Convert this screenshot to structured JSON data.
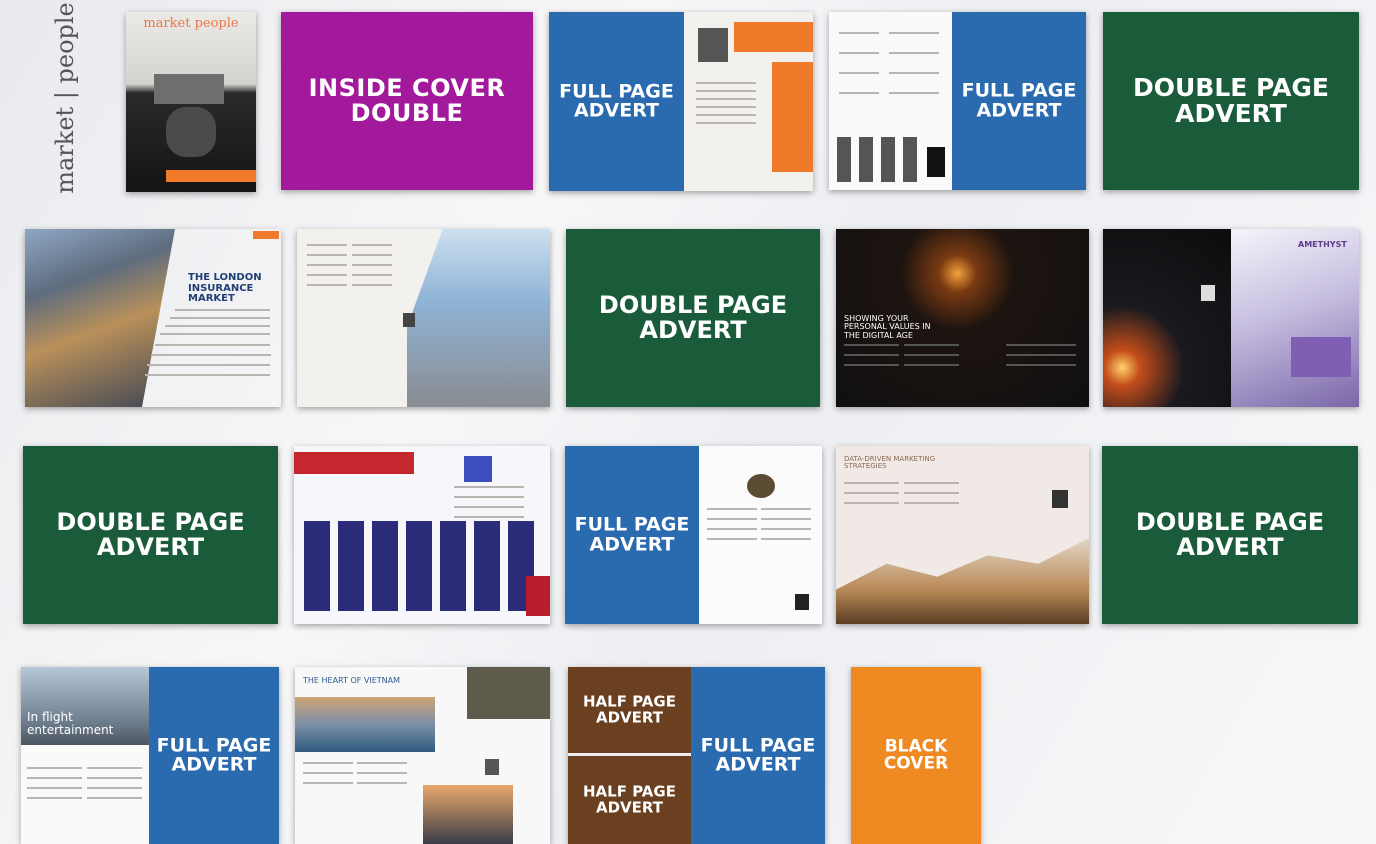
{
  "brand": {
    "name": "market | people"
  },
  "cover": {
    "title": "market people"
  },
  "adverts": {
    "inside_cover_double": "INSIDE COVER DOUBLE",
    "full_page_1": "FULL PAGE ADVERT",
    "full_page_2": "FULL PAGE ADVERT",
    "double_page_1": "DOUBLE PAGE ADVERT",
    "double_page_2": "DOUBLE PAGE ADVERT",
    "double_page_3": "DOUBLE PAGE ADVERT",
    "double_page_4": "DOUBLE PAGE ADVERT",
    "full_page_3": "FULL PAGE ADVERT",
    "full_page_4": "FULL PAGE ADVERT",
    "half_page_1": "HALF PAGE ADVERT",
    "half_page_2": "HALF PAGE ADVERT",
    "full_page_5": "FULL PAGE ADVERT",
    "black_cover": "BLACK COVER"
  },
  "articles": {
    "london_title": "THE LONDON INSURANCE MARKET",
    "values_title": "SHOWING YOUR PERSONAL VALUES IN THE DIGITAL AGE",
    "amethyst_title": "AMETHYST",
    "marketing_title": "DATA-DRIVEN MARKETING STRATEGIES",
    "inflight_title": "In flight entertainment",
    "vietnam_title": "THE HEART OF VIETNAM"
  },
  "colors": {
    "green": "#1a5c3a",
    "magenta": "#a3199b",
    "blue": "#2a6aae",
    "brown": "#6b4020",
    "orange": "#ef8a22"
  }
}
